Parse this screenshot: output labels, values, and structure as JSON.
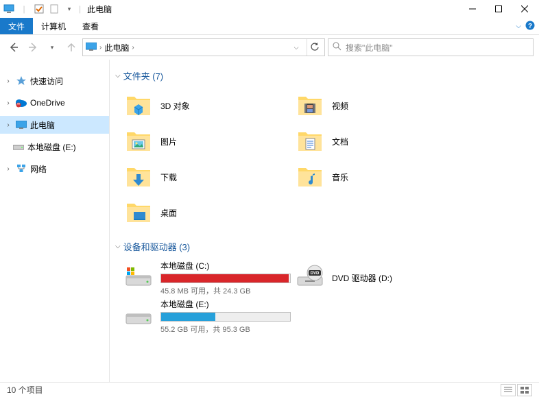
{
  "window": {
    "title": "此电脑"
  },
  "menu": {
    "file": "文件",
    "computer": "计算机",
    "view": "查看"
  },
  "addressbar": {
    "crumb1": "此电脑",
    "crumb_sep": "›"
  },
  "search": {
    "placeholder": "搜索\"此电脑\""
  },
  "sidebar": {
    "quick_access": "快速访问",
    "onedrive": "OneDrive",
    "this_pc": "此电脑",
    "local_disk_e": "本地磁盘 (E:)",
    "network": "网络"
  },
  "groups": {
    "folders_header": "文件夹 (7)",
    "drives_header": "设备和驱动器 (3)"
  },
  "folders": {
    "objects3d": "3D 对象",
    "videos": "视频",
    "pictures": "图片",
    "documents": "文档",
    "downloads": "下载",
    "music": "音乐",
    "desktop": "桌面"
  },
  "drives": {
    "c": {
      "name": "本地磁盘 (C:)",
      "stat": "45.8 MB 可用，共 24.3 GB",
      "fill_pct": 99,
      "color": "#d9262a"
    },
    "e": {
      "name": "本地磁盘 (E:)",
      "stat": "55.2 GB 可用，共 95.3 GB",
      "fill_pct": 42,
      "color": "#26a0da"
    },
    "dvd": {
      "name": "DVD 驱动器 (D:)"
    }
  },
  "statusbar": {
    "count": "10 个项目"
  }
}
